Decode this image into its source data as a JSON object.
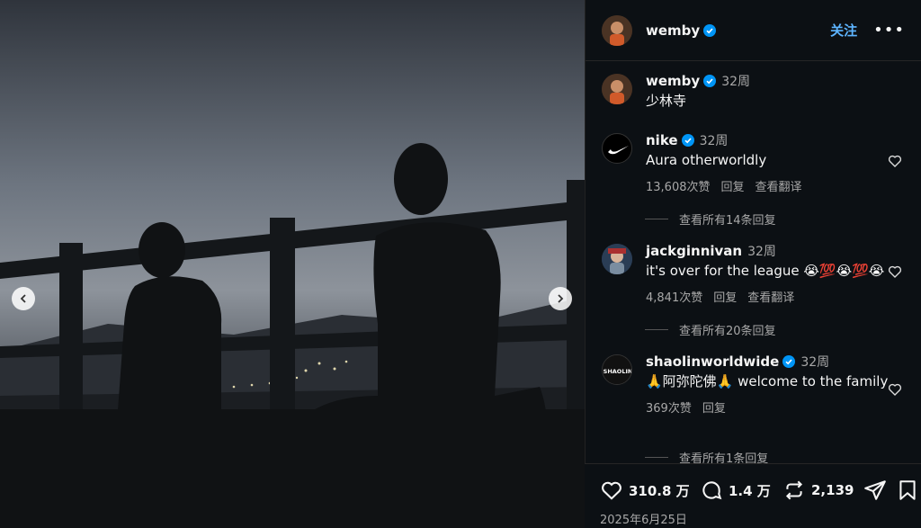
{
  "post": {
    "author": "wemby",
    "follow_label": "关注",
    "more_label": "•••",
    "caption_time": "32周",
    "caption_text": "少林寺"
  },
  "comments": [
    {
      "user": "nike",
      "time": "32周",
      "text": "Aura otherworldly",
      "likes": "13,608次赞",
      "reply": "回复",
      "translate": "查看翻译",
      "view_replies": "查看所有14条回复"
    },
    {
      "user": "jackginnivan",
      "time": "32周",
      "text": "it's over for the league 😭💯😭💯😭",
      "likes": "4,841次赞",
      "reply": "回复",
      "translate": "查看翻译",
      "view_replies": "查看所有20条回复"
    },
    {
      "user": "shaolinworldwide",
      "time": "32周",
      "text": "🙏阿弥陀佛🙏 welcome to the family",
      "likes": "369次赞",
      "reply": "回复",
      "view_replies": "查看所有1条回复"
    }
  ],
  "shaolin_logo_text": "SHAOLIN",
  "actions": {
    "likes": "310.8 万",
    "comments": "1.4 万",
    "reposts": "2,139",
    "date": "2025年6月25日"
  },
  "colors": {
    "accent": "#5db4ff",
    "verified": "#0095f6",
    "panel_bg": "#0c1014"
  }
}
